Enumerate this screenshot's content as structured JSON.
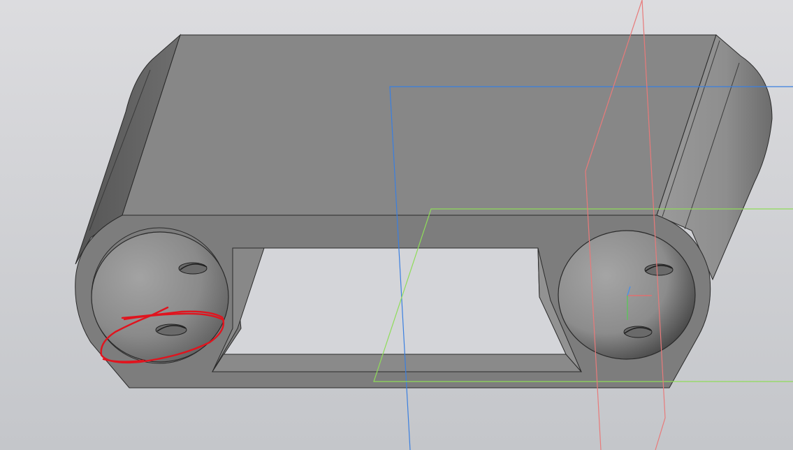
{
  "viewport": {
    "kind": "3d-model-view",
    "background_top": "#dcdcdf",
    "background_bottom": "#c4c6ca"
  },
  "model": {
    "body_color": "#8a8a8a",
    "edge_color": "#2a2a2a",
    "opening_color": "#d4d5d9"
  },
  "construction_planes": [
    {
      "name": "plane-blue",
      "color": "#3a7fe0"
    },
    {
      "name": "plane-green",
      "color": "#8fdc5a"
    },
    {
      "name": "plane-red",
      "color": "#e87a7a"
    }
  ],
  "triad": {
    "x_axis_color": "#e07070",
    "y_axis_color": "#60c060",
    "z_axis_color": "#5090e0"
  },
  "annotation": {
    "kind": "freehand-circle",
    "color": "#e0141e",
    "target": "lower-left-hole"
  }
}
